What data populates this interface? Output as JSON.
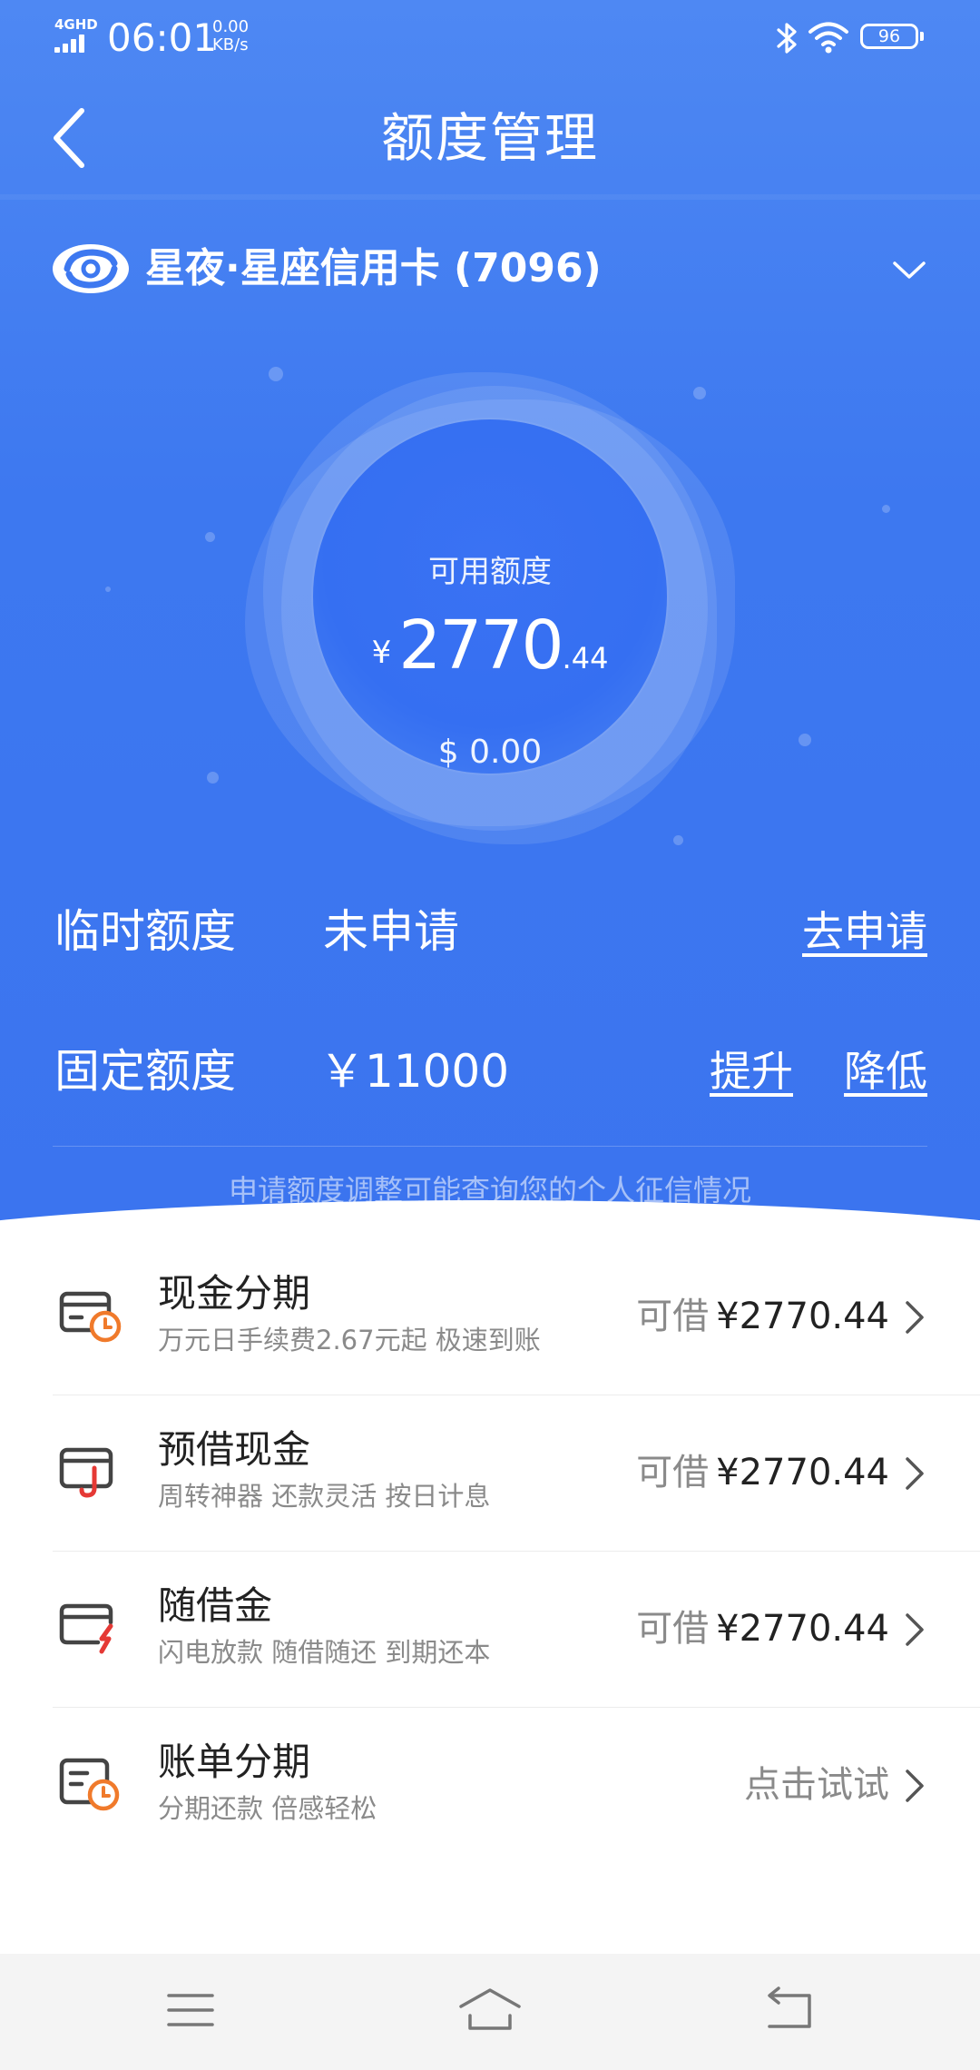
{
  "status_bar": {
    "network": "4GHD",
    "time": "06:01",
    "speed_value": "0.00",
    "speed_unit": "KB/s",
    "battery": "96"
  },
  "nav": {
    "title": "额度管理"
  },
  "card": {
    "name": "星夜·星座信用卡 (7096)"
  },
  "available": {
    "label": "可用额度",
    "currency": "¥",
    "integer": "2770",
    "decimal": ".44",
    "usd": "$ 0.00"
  },
  "temp_quota": {
    "label": "临时额度",
    "value": "未申请",
    "action": "去申请"
  },
  "fixed_quota": {
    "label": "固定额度",
    "value": "￥11000",
    "increase": "提升",
    "decrease": "降低"
  },
  "notice": "申请额度调整可能查询您的个人征信情况",
  "products": [
    {
      "title": "现金分期",
      "subtitle": "万元日手续费2.67元起 极速到账",
      "prefix": "可借",
      "amount": "¥2770.44",
      "icon": "card-clock-icon",
      "accent": "#f07a2b"
    },
    {
      "title": "预借现金",
      "subtitle": "周转神器 还款灵活 按日计息",
      "prefix": "可借",
      "amount": "¥2770.44",
      "icon": "card-hook-icon",
      "accent": "#e53935"
    },
    {
      "title": "随借金",
      "subtitle": "闪电放款 随借随还 到期还本",
      "prefix": "可借",
      "amount": "¥2770.44",
      "icon": "card-lightning-icon",
      "accent": "#e53935"
    },
    {
      "title": "账单分期",
      "subtitle": "分期还款 倍感轻松",
      "prefix": "点击试试",
      "amount": "",
      "icon": "bill-clock-icon",
      "accent": "#f07a2b"
    }
  ],
  "colors": {
    "hero": "#3d78f0",
    "white": "#ffffff",
    "accent_orange": "#f07a2b",
    "accent_red": "#e53935"
  }
}
